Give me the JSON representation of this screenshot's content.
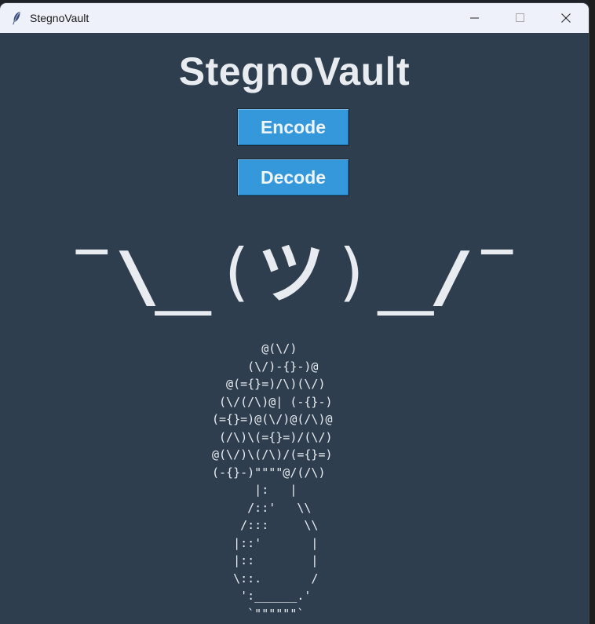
{
  "window": {
    "title": "StegnoVault",
    "icon": "feather-icon",
    "controls": [
      "minimize-icon",
      "maximize-icon",
      "close-icon"
    ]
  },
  "app": {
    "heading": "StegnoVault",
    "encode_label": "Encode",
    "decode_label": "Decode"
  },
  "shrug": {
    "left_arm": "¯\\_",
    "open_paren": "(",
    "face": "ツ",
    "close_paren": ")",
    "right_arm": "_/¯"
  },
  "ascii_art": {
    "lines": [
      "       @(\\/)",
      "     (\\/)-{}-)@",
      "  @(={}=)/\\)(\\/)",
      " (\\/(/\\)@| (-{}-)",
      "(={}=)@(\\/)@(/\\)@",
      " (/\\)\\(={}=)/(\\/)",
      "@(\\/)\\(/\\)/(={}=)",
      "(-{}-)\"\"\"\"@/(/\\)",
      "      |:   |",
      "     /::'   \\\\",
      "    /:::     \\\\",
      "   |::'       |",
      "   |::        |",
      "   \\::.       /",
      "    ':______.'",
      "     `\"\"\"\"\"\"`"
    ]
  },
  "colors": {
    "background": "#2e3e4f",
    "button": "#3498db",
    "text": "#e8ecf0",
    "titlebar": "#eef1f9"
  }
}
